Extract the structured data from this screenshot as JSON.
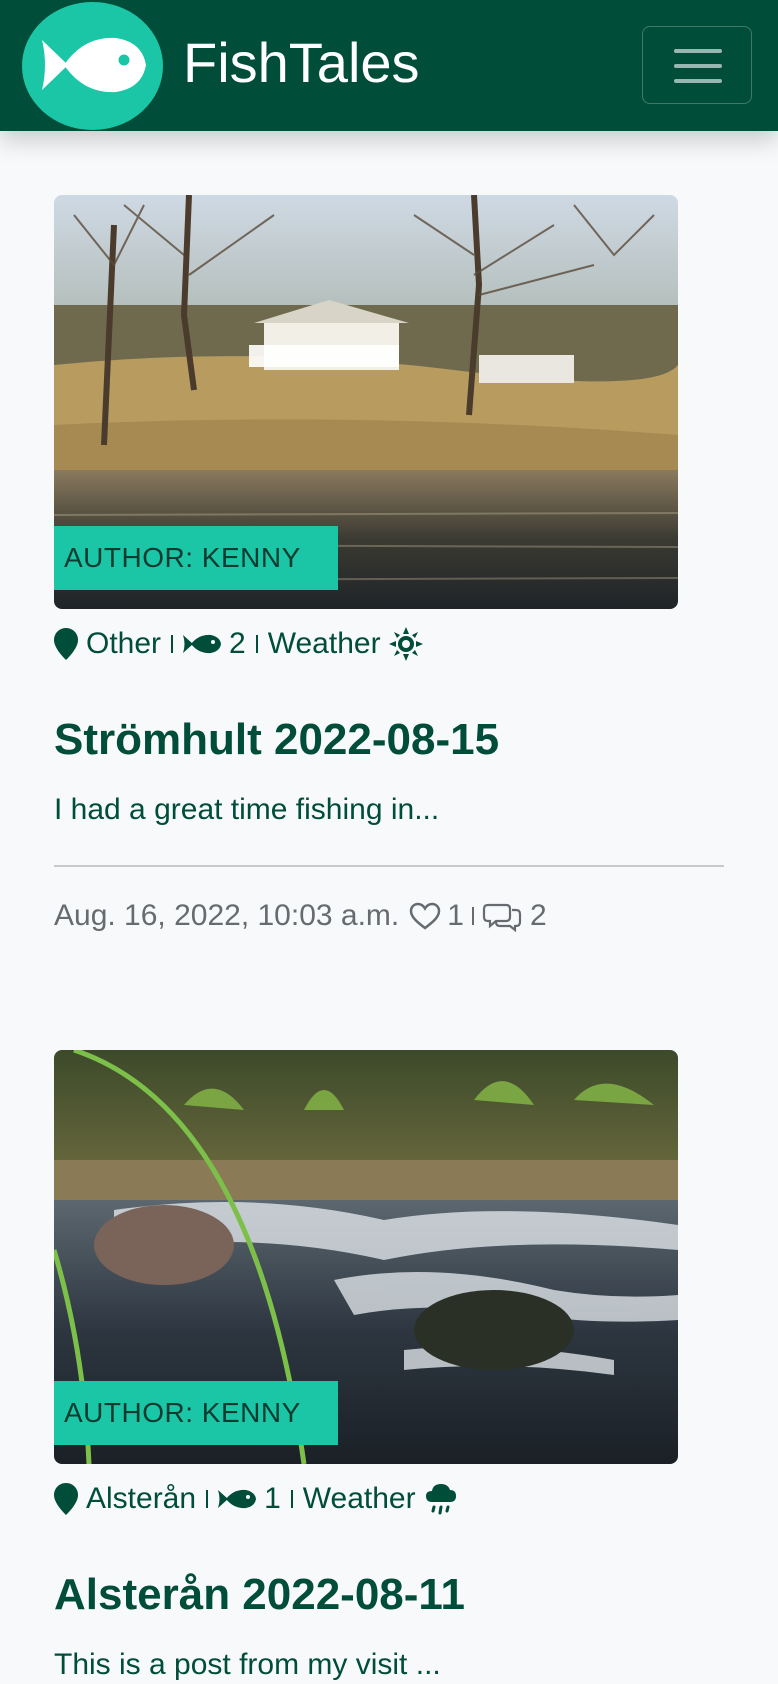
{
  "navbar": {
    "brand": "FishTales",
    "logo_icon": "fish-icon",
    "menu_icon": "hamburger-icon"
  },
  "colors": {
    "primary": "#004d3a",
    "accent": "#1bc6a6",
    "background": "#f8f9fb",
    "muted": "#666b70"
  },
  "posts": [
    {
      "author": "AUTHOR: KENNY",
      "location": "Other",
      "fish_count": "2",
      "weather_label": "Weather",
      "weather_icon": "sun-icon",
      "title": "Strömhult 2022-08-15",
      "excerpt": "I had a great time fishing in...",
      "date": "Aug. 16, 2022, 10:03 a.m.",
      "likes": "1",
      "comments": "2"
    },
    {
      "author": "AUTHOR: KENNY",
      "location": "Alsterån",
      "fish_count": "1",
      "weather_label": "Weather",
      "weather_icon": "rain-cloud-icon",
      "title": "Alsterån 2022-08-11",
      "excerpt": "This is a post from my visit ..."
    }
  ]
}
